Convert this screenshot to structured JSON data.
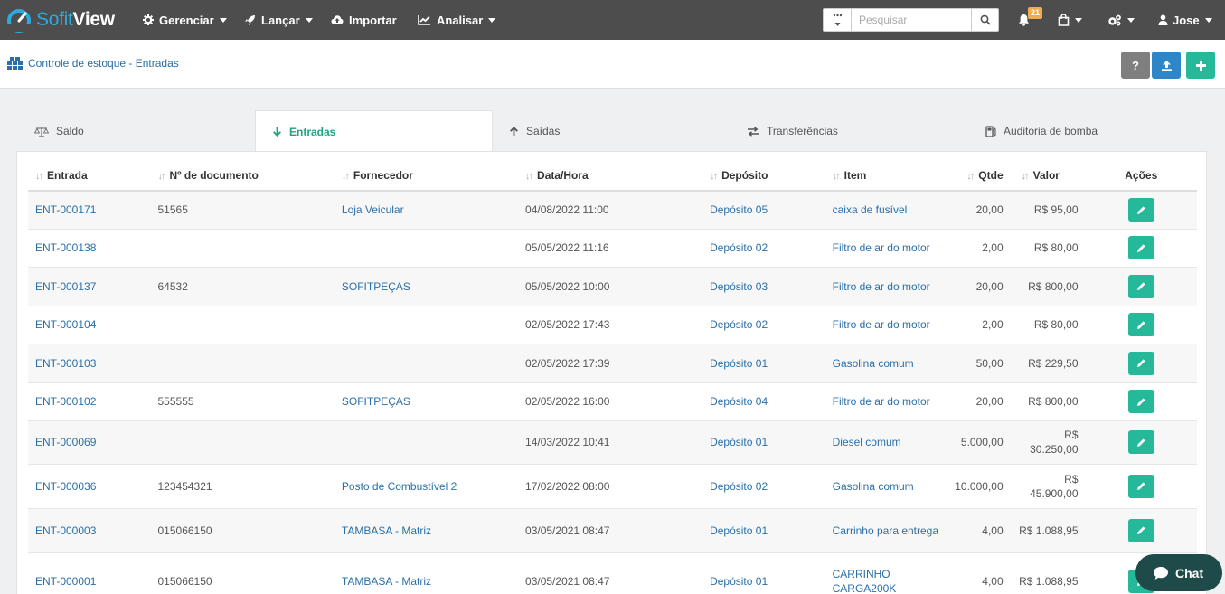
{
  "brand": {
    "part1": "Sofit",
    "part2": "View"
  },
  "nav": {
    "gerenciar": "Gerenciar",
    "lancar": "Lançar",
    "importar": "Importar",
    "analisar": "Analisar"
  },
  "search": {
    "placeholder": "Pesquisar"
  },
  "notifications": {
    "count": "21"
  },
  "user": {
    "name": "Jose"
  },
  "breadcrumb": {
    "label": "Controle de estoque - Entradas"
  },
  "header_buttons": {
    "help": "?"
  },
  "tabs": [
    {
      "label": "Saldo"
    },
    {
      "label": "Entradas"
    },
    {
      "label": "Saídas"
    },
    {
      "label": "Transferências"
    },
    {
      "label": "Auditoria de bomba"
    }
  ],
  "table": {
    "columns": [
      "Entrada",
      "Nº de documento",
      "Fornecedor",
      "Data/Hora",
      "Depósito",
      "Item",
      "Qtde",
      "Valor",
      "Ações"
    ],
    "rows": [
      {
        "entrada": "ENT-000171",
        "documento": "51565",
        "fornecedor": "Loja Veicular",
        "data": "04/08/2022 11:00",
        "deposito": "Depósito 05",
        "item": "caixa de fusível",
        "qtde": "20,00",
        "valor": "R$ 95,00"
      },
      {
        "entrada": "ENT-000138",
        "documento": "",
        "fornecedor": "",
        "data": "05/05/2022 11:16",
        "deposito": "Depósito 02",
        "item": "Filtro de ar do motor",
        "qtde": "2,00",
        "valor": "R$ 80,00"
      },
      {
        "entrada": "ENT-000137",
        "documento": "64532",
        "fornecedor": "SOFITPEÇAS",
        "data": "05/05/2022 10:00",
        "deposito": "Depósito 03",
        "item": "Filtro de ar do motor",
        "qtde": "20,00",
        "valor": "R$ 800,00"
      },
      {
        "entrada": "ENT-000104",
        "documento": "",
        "fornecedor": "",
        "data": "02/05/2022 17:43",
        "deposito": "Depósito 02",
        "item": "Filtro de ar do motor",
        "qtde": "2,00",
        "valor": "R$ 80,00"
      },
      {
        "entrada": "ENT-000103",
        "documento": "",
        "fornecedor": "",
        "data": "02/05/2022 17:39",
        "deposito": "Depósito 01",
        "item": "Gasolina comum",
        "qtde": "50,00",
        "valor": "R$ 229,50"
      },
      {
        "entrada": "ENT-000102",
        "documento": "555555",
        "fornecedor": "SOFITPEÇAS",
        "data": "02/05/2022 16:00",
        "deposito": "Depósito 04",
        "item": "Filtro de ar do motor",
        "qtde": "20,00",
        "valor": "R$ 800,00"
      },
      {
        "entrada": "ENT-000069",
        "documento": "",
        "fornecedor": "",
        "data": "14/03/2022 10:41",
        "deposito": "Depósito 01",
        "item": "Diesel comum",
        "qtde": "5.000,00",
        "valor": "R$ 30.250,00"
      },
      {
        "entrada": "ENT-000036",
        "documento": "123454321",
        "fornecedor": "Posto de Combustível 2",
        "data": "17/02/2022 08:00",
        "deposito": "Depósito 02",
        "item": "Gasolina comum",
        "qtde": "10.000,00",
        "valor": "R$ 45.900,00"
      },
      {
        "entrada": "ENT-000003",
        "documento": "015066150",
        "fornecedor": "TAMBASA - Matriz",
        "data": "03/05/2021 08:47",
        "deposito": "Depósito 01",
        "item": "Carrinho para entrega",
        "qtde": "4,00",
        "valor": "R$ 1.088,95"
      },
      {
        "entrada": "ENT-000001",
        "documento": "015066150",
        "fornecedor": "TAMBASA - Matriz",
        "data": "03/05/2021 08:47",
        "deposito": "Depósito 01",
        "item": "CARRINHO CARGA200K",
        "qtde": "4,00",
        "valor": "R$ 1.088,95"
      }
    ]
  },
  "chat": {
    "label": "Chat"
  },
  "colors": {
    "navbar": "#4d4d4d",
    "accent_green": "#26b999",
    "link_blue": "#2a6fa8",
    "badge": "#f0ad4e"
  }
}
